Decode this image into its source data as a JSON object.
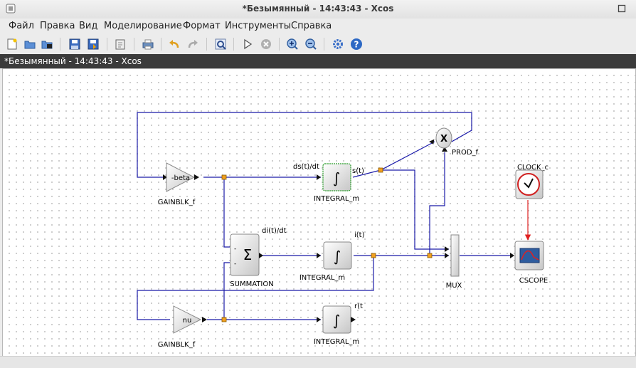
{
  "window": {
    "title": "*Безымянный - 14:43:43 - Xcos"
  },
  "menu": [
    "Файл",
    "Правка",
    "Вид",
    "Моделирование",
    "Формат",
    "Инструменты",
    "Справка"
  ],
  "toolbar": {
    "icons": [
      "new-diagram-icon",
      "open-icon",
      "open-in-scilab-icon",
      "save-icon",
      "save-as-icon",
      "export-icon",
      "print-icon",
      "undo-icon",
      "redo-icon",
      "fit-diagram-icon",
      "start-icon",
      "stop-icon",
      "zoom-in-icon",
      "zoom-out-icon",
      "setup-icon",
      "help-icon"
    ]
  },
  "doc_tab": {
    "title": "*Безымянный - 14:43:43 - Xcos"
  },
  "diagram": {
    "blocks": {
      "gain_beta": {
        "text": "-beta",
        "caption": "GAINBLK_f"
      },
      "integral_s": {
        "caption": "INTEGRAL_m",
        "in_label": "ds(t)/dt",
        "out_label": "s(t)"
      },
      "prod": {
        "text": "X",
        "caption": "PROD_f"
      },
      "clock": {
        "caption": "CLOCK_c"
      },
      "summation": {
        "symbol": "Σ",
        "caption": "SUMMATION",
        "out_label": "di(t)/dt",
        "sign1": "-",
        "sign2": "-"
      },
      "integral_i": {
        "caption": "INTEGRAL_m",
        "out_label": "i(t)"
      },
      "mux": {
        "caption": "MUX"
      },
      "cscope": {
        "caption": "CSCOPE"
      },
      "gain_nu": {
        "text": "nu",
        "caption": "GAINBLK_f"
      },
      "integral_r": {
        "caption": "INTEGRAL_m",
        "out_label": "r(t"
      }
    }
  },
  "colors": {
    "link": "#1a1aa8",
    "event_link": "#e02020",
    "split": "#f0a020",
    "selection": "#2a9d2a"
  }
}
